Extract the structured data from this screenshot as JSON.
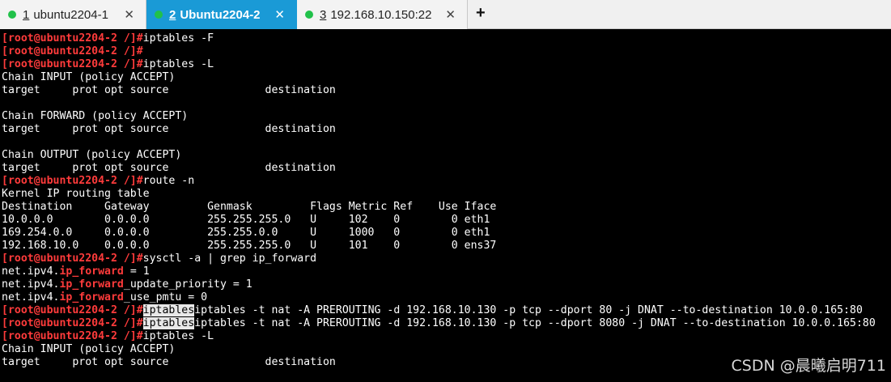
{
  "tabs": [
    {
      "num": "1",
      "title": "ubuntu2204-1",
      "close": "✕"
    },
    {
      "num": "2",
      "title": "Ubuntu2204-2",
      "close": "✕"
    },
    {
      "num": "3",
      "title": "192.168.10.150:22",
      "close": "✕"
    }
  ],
  "new_tab_label": "+",
  "prompt": "[root@ubuntu2204-2 /]#",
  "lines": {
    "l1_cmd": "iptables -F",
    "l3_cmd": "iptables -L",
    "chain_input": "Chain INPUT (policy ACCEPT)",
    "target_hdr": "target     prot opt source               destination",
    "chain_forward": "Chain FORWARD (policy ACCEPT)",
    "chain_output": "Chain OUTPUT (policy ACCEPT)",
    "route_cmd": "route -n",
    "kernel_table": "Kernel IP routing table",
    "route_hdr": "Destination     Gateway         Genmask         Flags Metric Ref    Use Iface",
    "route_1": "10.0.0.0        0.0.0.0         255.255.255.0   U     102    0        0 eth1",
    "route_2": "169.254.0.0     0.0.0.0         255.255.0.0     U     1000   0        0 eth1",
    "route_3": "192.168.10.0    0.0.0.0         255.255.255.0   U     101    0        0 ens37",
    "sysctl_cmd": "sysctl -a | grep ip_forward",
    "fw1_a": "net.ipv4.",
    "fw_red": "ip_forward",
    "fw1_b": " = 1",
    "fw2_b": "_update_priority = 1",
    "fw3_b": "_use_pmtu = 0",
    "hl_word": "iptables",
    "dnat_1": "iptables -t nat -A PREROUTING -d 192.168.10.130 -p tcp --dport 80 -j DNAT --to-destination 10.0.0.165:80",
    "dnat_2": "iptables -t nat -A PREROUTING -d 192.168.10.130 -p tcp --dport 8080 -j DNAT --to-destination 10.0.0.165:80",
    "last_cmd": "iptables -L"
  },
  "watermark": "CSDN @晨曦启明711"
}
